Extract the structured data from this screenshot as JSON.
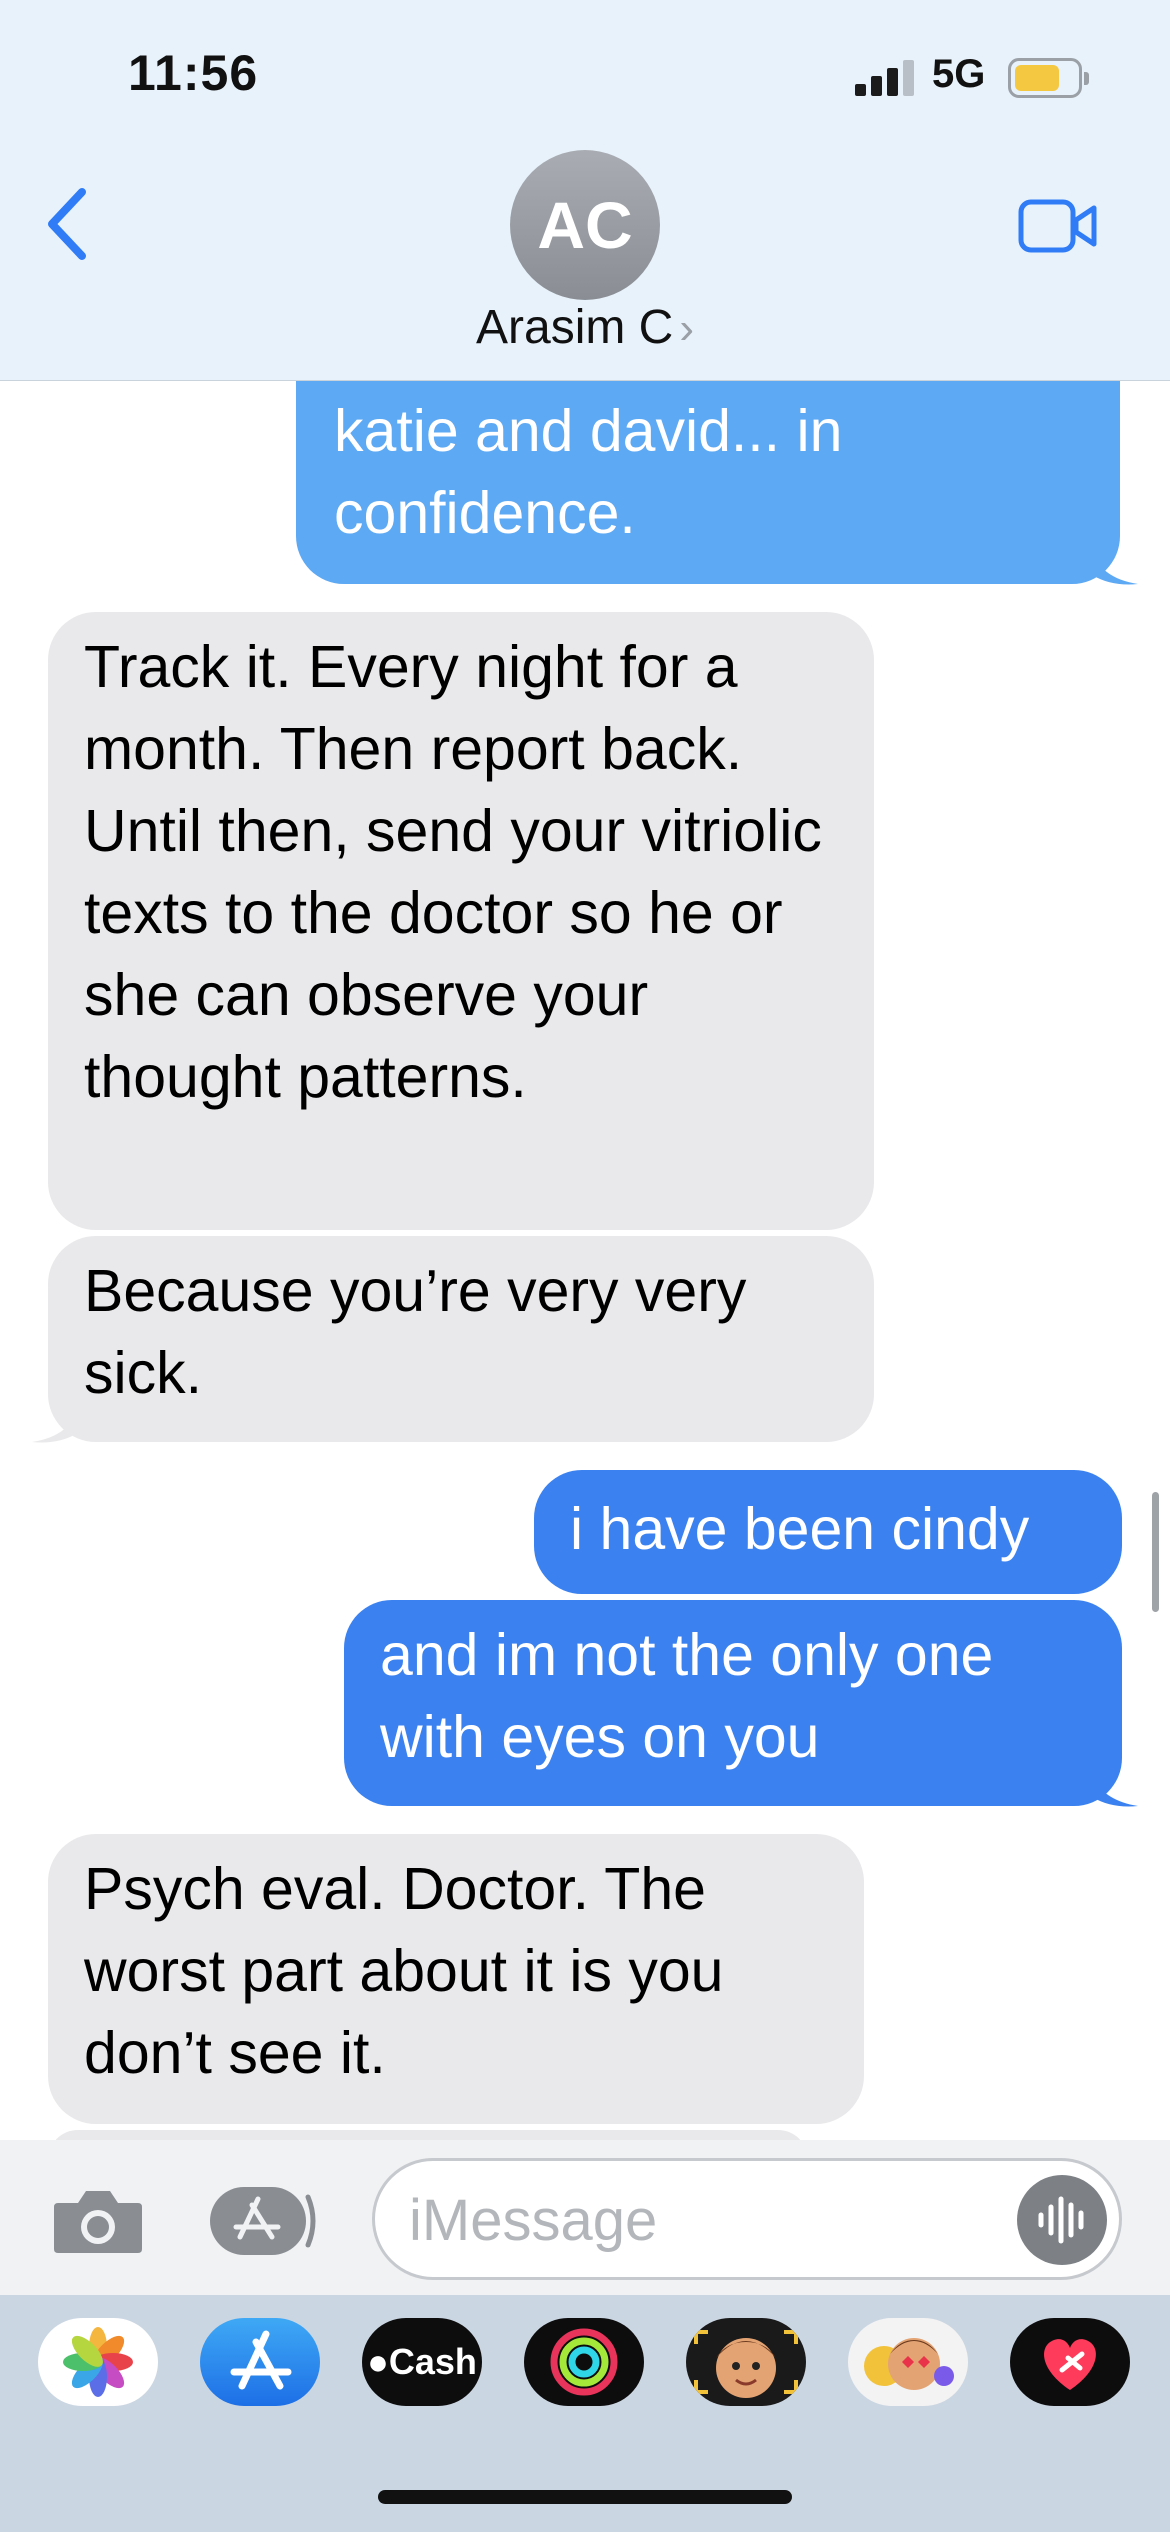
{
  "status_bar": {
    "time": "11:56",
    "network": "5G"
  },
  "header": {
    "avatar_initials": "AC",
    "contact_name": "Arasim C",
    "contact_chevron": "›"
  },
  "messages": [
    {
      "direction": "out",
      "text": "katie and david... in confidence."
    },
    {
      "direction": "in",
      "text": "Track it.  Every night for a month.  Then report back.  Until then, send your vitriolic texts to the doctor so he or she can observe your thought patterns."
    },
    {
      "direction": "in",
      "text": "Because you’re very very sick."
    },
    {
      "direction": "out",
      "text": "i have been cindy"
    },
    {
      "direction": "out",
      "text": "and im not the only one with eyes on you"
    },
    {
      "direction": "in",
      "text": "Psych eval. Doctor. The worst part about it is you don’t see it."
    }
  ],
  "composer": {
    "placeholder": "iMessage"
  },
  "app_drawer": [
    {
      "name": "photos-app-icon"
    },
    {
      "name": "app-store-icon"
    },
    {
      "name": "apple-cash-icon",
      "label": "Cash"
    },
    {
      "name": "activity-icon"
    },
    {
      "name": "memoji-icon"
    },
    {
      "name": "memoji-stickers-icon"
    },
    {
      "name": "digital-touch-icon"
    }
  ]
}
